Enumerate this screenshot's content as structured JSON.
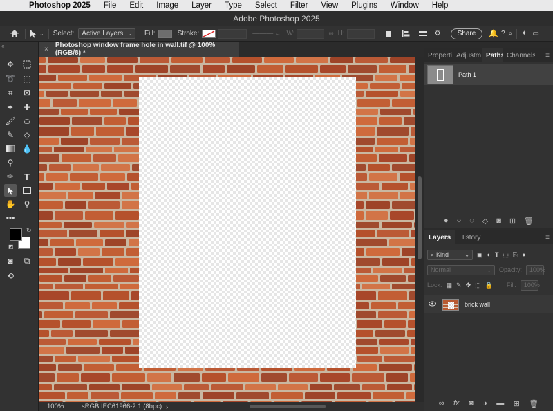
{
  "menubar": {
    "items": [
      "Photoshop 2025",
      "File",
      "Edit",
      "Image",
      "Layer",
      "Type",
      "Select",
      "Filter",
      "View",
      "Plugins",
      "Window",
      "Help"
    ]
  },
  "window": {
    "title": "Adobe Photoshop 2025"
  },
  "options": {
    "select_label": "Select:",
    "select_value": "Active Layers",
    "fill_label": "Fill:",
    "stroke_label": "Stroke:",
    "w_label": "W:",
    "h_label": "H:",
    "share_label": "Share"
  },
  "document": {
    "tab_title": "Photoshop window frame hole in wall.tif @ 100% (RGB/8) *",
    "zoom": "100%",
    "profile": "sRGB IEC61966-2.1 (8bpc)"
  },
  "paths_panel": {
    "tabs": [
      "Properti",
      "Adjustm",
      "Paths",
      "Channels"
    ],
    "active_tab": "Paths",
    "paths": [
      {
        "name": "Path 1"
      }
    ]
  },
  "layers_panel": {
    "tabs": [
      "Layers",
      "History"
    ],
    "active_tab": "Layers",
    "filter_kind": "Kind",
    "blend_mode": "Normal",
    "opacity_label": "Opacity:",
    "opacity_value": "100%",
    "lock_label": "Lock:",
    "fill_label": "Fill:",
    "fill_value": "100%",
    "layers": [
      {
        "name": "brick wall",
        "visible": true
      }
    ]
  },
  "colors": {
    "foreground": "#000000",
    "background": "#ffffff",
    "accent_active": "#575757"
  }
}
